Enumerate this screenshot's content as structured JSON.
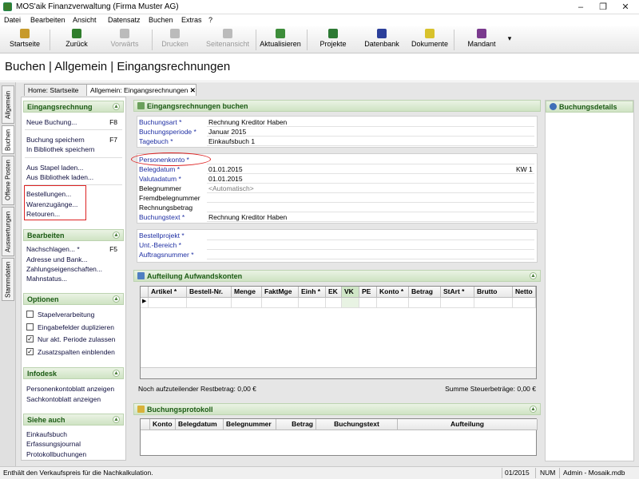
{
  "window": {
    "title": "MOS'aik Finanzverwaltung (Firma Muster AG)",
    "minimize": "–",
    "maximize": "❐",
    "close": "✕"
  },
  "menu": [
    "Datei",
    "Bearbeiten",
    "Ansicht",
    "Datensatz",
    "Buchen",
    "Extras",
    "?"
  ],
  "toolbar": {
    "buttons": [
      {
        "label": "Startseite",
        "icon": "home-icon",
        "enabled": true
      },
      {
        "label": "Zurück",
        "icon": "back-arrow-icon",
        "enabled": true
      },
      {
        "label": "Vorwärts",
        "icon": "forward-arrow-icon",
        "enabled": false
      },
      {
        "label": "Drucken",
        "icon": "printer-icon",
        "enabled": false
      },
      {
        "label": "Seitenansicht",
        "icon": "page-preview-icon",
        "enabled": false
      },
      {
        "label": "Aktualisieren",
        "icon": "refresh-icon",
        "enabled": true
      },
      {
        "label": "Projekte",
        "icon": "projects-icon",
        "enabled": true
      },
      {
        "label": "Datenbank",
        "icon": "database-icon",
        "enabled": true
      },
      {
        "label": "Dokumente",
        "icon": "documents-icon",
        "enabled": true
      },
      {
        "label": "Mandant",
        "icon": "client-icon",
        "enabled": true
      }
    ],
    "dropdown": "▾"
  },
  "page_title": "Buchen | Allgemein | Eingangsrechnungen",
  "side_tabs": [
    "Allgemein",
    "Buchen",
    "Offene Posten",
    "Auswertungen",
    "Stammdaten"
  ],
  "doc_tabs": [
    {
      "label": "Home: Startseite"
    },
    {
      "label": "Allgemein: Eingangsrechnungen",
      "close": "✕"
    }
  ],
  "taskpane": {
    "expand_glyph": "▲",
    "sections": [
      {
        "title": "Eingangsrechnung",
        "items": [
          {
            "label": "Neue Buchung...",
            "key": "F8"
          },
          {
            "label": "Buchung speichern",
            "key": "F7"
          },
          {
            "label": "In Bibliothek speichern",
            "key": ""
          },
          {
            "label": "Aus Stapel laden...",
            "key": ""
          },
          {
            "label": "Aus Bibliothek laden...",
            "key": ""
          },
          {
            "label": "Bestellungen...",
            "key": ""
          },
          {
            "label": "Warenzugänge...",
            "key": ""
          },
          {
            "label": "Retouren...",
            "key": ""
          }
        ]
      },
      {
        "title": "Bearbeiten",
        "items": [
          {
            "label": "Nachschlagen... *",
            "key": "F5"
          },
          {
            "label": "Adresse und Bank...",
            "key": ""
          },
          {
            "label": "Zahlungseigenschaften...",
            "key": ""
          },
          {
            "label": "Mahnstatus...",
            "key": ""
          }
        ]
      },
      {
        "title": "Optionen",
        "checks": [
          {
            "label": "Stapelverarbeitung",
            "checked": false
          },
          {
            "label": "Eingabefelder duplizieren",
            "checked": false
          },
          {
            "label": "Nur akt. Periode zulassen",
            "checked": true
          },
          {
            "label": "Zusatzspalten einblenden",
            "checked": true
          }
        ]
      },
      {
        "title": "Infodesk",
        "items": [
          {
            "label": "Personenkontoblatt anzeigen",
            "key": ""
          },
          {
            "label": "Sachkontoblatt anzeigen",
            "key": ""
          }
        ]
      },
      {
        "title": "Siehe auch",
        "items": [
          {
            "label": "Einkaufsbuch",
            "key": ""
          },
          {
            "label": "Erfassungsjournal",
            "key": ""
          },
          {
            "label": "Protokollbuchungen",
            "key": ""
          }
        ]
      }
    ]
  },
  "form": {
    "title": "Eingangsrechnungen buchen",
    "group1": [
      {
        "label": "Buchungsart *",
        "value": "Rechnung Kreditor Haben",
        "required": true
      },
      {
        "label": "Buchungsperiode *",
        "value": "Januar 2015",
        "required": true
      },
      {
        "label": "Tagebuch *",
        "value": "Einkaufsbuch 1",
        "required": true
      }
    ],
    "group2": [
      {
        "label": "Personenkonto *",
        "value": "",
        "required": true
      },
      {
        "label": "Belegdatum *",
        "value": "01.01.2015",
        "required": true,
        "extra": "KW 1"
      },
      {
        "label": "Valutadatum *",
        "value": "01.01.2015",
        "required": true
      },
      {
        "label": "Belegnummer",
        "value": "<Automatisch>",
        "required": false,
        "muted": true
      },
      {
        "label": "Fremdbelegnummer",
        "value": "",
        "required": false
      },
      {
        "label": "Rechnungsbetrag",
        "value": "",
        "required": false
      },
      {
        "label": "Buchungstext *",
        "value": "Rechnung Kreditor Haben",
        "required": true
      }
    ],
    "group3": [
      {
        "label": "Bestellprojekt *",
        "value": "",
        "required": true
      },
      {
        "label": "Unt.-Bereich *",
        "value": "",
        "required": true
      },
      {
        "label": "Auftragsnummer *",
        "value": "",
        "required": true
      }
    ]
  },
  "aufteilung": {
    "title": "Aufteilung Aufwandskonten",
    "row_marker": "▶",
    "columns": [
      "Artikel *",
      "Bestell-Nr.",
      "Menge",
      "FaktMge",
      "Einh *",
      "EK",
      "VK",
      "PE",
      "Konto *",
      "Betrag",
      "StArt *",
      "Brutto",
      "Netto"
    ],
    "footer_left": "Noch aufzuteilender Restbetrag: 0,00 €",
    "footer_right": "Summe Steuerbeträge: 0,00 €"
  },
  "protokoll": {
    "title": "Buchungsprotokoll",
    "columns": [
      "Konto",
      "Belegdatum",
      "Belegnummer",
      "Betrag",
      "Buchungstext",
      "Aufteilung"
    ]
  },
  "details": {
    "title": "Buchungsdetails"
  },
  "status": {
    "message": "Enthält den Verkaufspreis für die Nachkalkulation.",
    "period": "01/2015",
    "num": "NUM",
    "db": "Admin - Mosaik.mdb"
  },
  "colors": {
    "accent_green": "#1a5a13",
    "required_blue": "#1f2fa3",
    "highlight_red": "#d22222"
  }
}
